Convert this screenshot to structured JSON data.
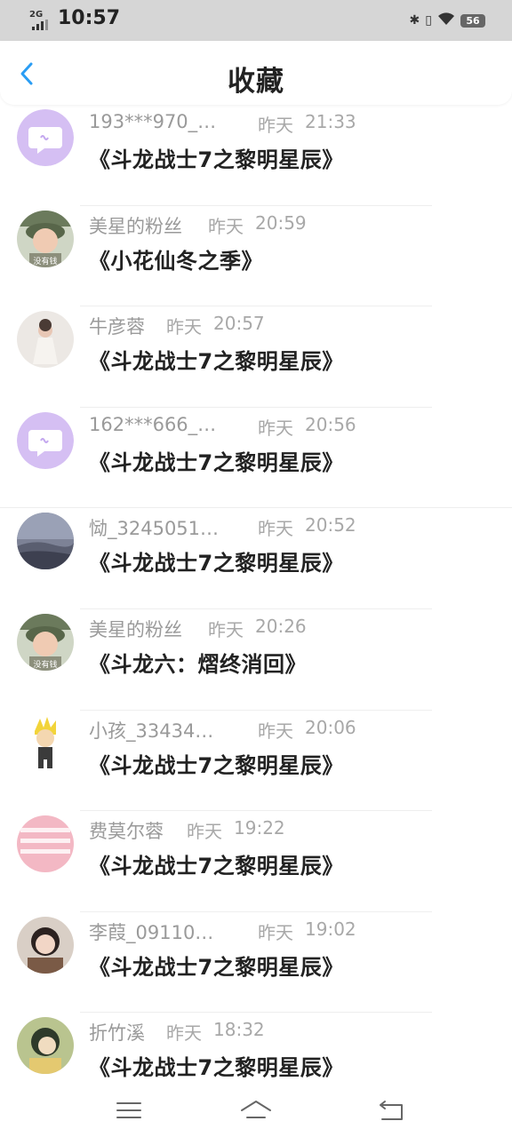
{
  "status_bar": {
    "network": "2G",
    "time": "10:57",
    "battery": "56"
  },
  "header": {
    "title": "收藏"
  },
  "items": [
    {
      "username": "193***970_…",
      "date": "昨天",
      "time": "21:33",
      "title": "《斗龙战士7之黎明星辰》",
      "avatar": "default-chat-icon"
    },
    {
      "username": "美星的粉丝",
      "date": "昨天",
      "time": "20:59",
      "title": "《小花仙冬之季》",
      "avatar": "child-photo"
    },
    {
      "username": "牛彦蓉",
      "date": "昨天",
      "time": "20:57",
      "title": "《斗龙战士7之黎明星辰》",
      "avatar": "girl-photo"
    },
    {
      "username": "162***666_…",
      "date": "昨天",
      "time": "20:56",
      "title": "《斗龙战士7之黎明星辰》",
      "avatar": "default-chat-icon"
    },
    {
      "username": "恸_3245051…",
      "date": "昨天",
      "time": "20:52",
      "title": "《斗龙战士7之黎明星辰》",
      "avatar": "sky-photo"
    },
    {
      "username": "美星的粉丝",
      "date": "昨天",
      "time": "20:26",
      "title": "《斗龙六：熠终消回》",
      "avatar": "child-photo"
    },
    {
      "username": "小孩_33434…",
      "date": "昨天",
      "time": "20:06",
      "title": "《斗龙战士7之黎明星辰》",
      "avatar": "cartoon-character"
    },
    {
      "username": "费莫尔蓉",
      "date": "昨天",
      "time": "19:22",
      "title": "《斗龙战士7之黎明星辰》",
      "avatar": "pink-pattern"
    },
    {
      "username": "李葭_09110…",
      "date": "昨天",
      "time": "19:02",
      "title": "《斗龙战士7之黎明星辰》",
      "avatar": "girl-selfie"
    },
    {
      "username": "折竹溪",
      "date": "昨天",
      "time": "18:32",
      "title": "《斗龙战士7之黎明星辰》",
      "avatar": "anime-character"
    }
  ],
  "nav_bar": {
    "icons": [
      "menu-icon",
      "home-icon",
      "back-nav-icon"
    ]
  },
  "colors": {
    "accent": "#2a9df4",
    "default_avatar": "#d5bff3"
  }
}
